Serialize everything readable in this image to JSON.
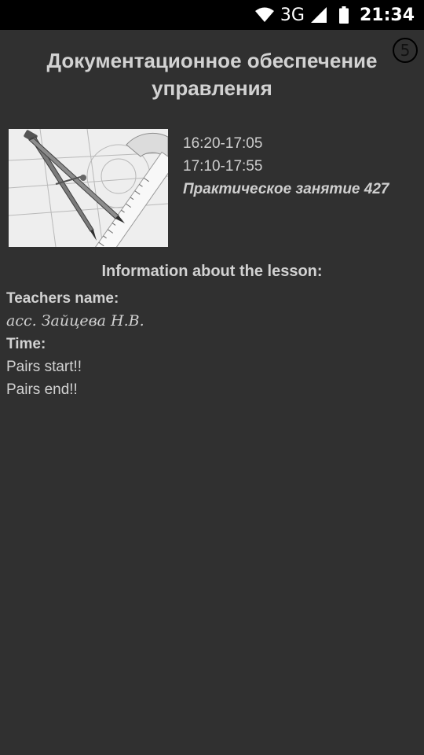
{
  "status_bar": {
    "network_label": "3G",
    "time": "21:34",
    "icons": [
      "wifi-icon",
      "signal-icon",
      "battery-icon"
    ]
  },
  "page_badge": "5",
  "lesson": {
    "title": "Документационное обеспечение управления",
    "image_icon": "drafting-compass-illustration",
    "time_start_range": "16:20-17:05",
    "time_end_range": "17:10-17:55",
    "type_room": "Практическое занятие 427"
  },
  "info": {
    "heading": "Information about the lesson:",
    "teacher_label": "Teachers name:",
    "teacher_value": "асс. Зайцева Н.В.",
    "time_label": "Time:",
    "pairs_start": "Pairs start!!",
    "pairs_end": "Pairs end!!"
  },
  "colors": {
    "background": "#303030",
    "status_bar": "#000000",
    "text": "#d2d2d2"
  }
}
